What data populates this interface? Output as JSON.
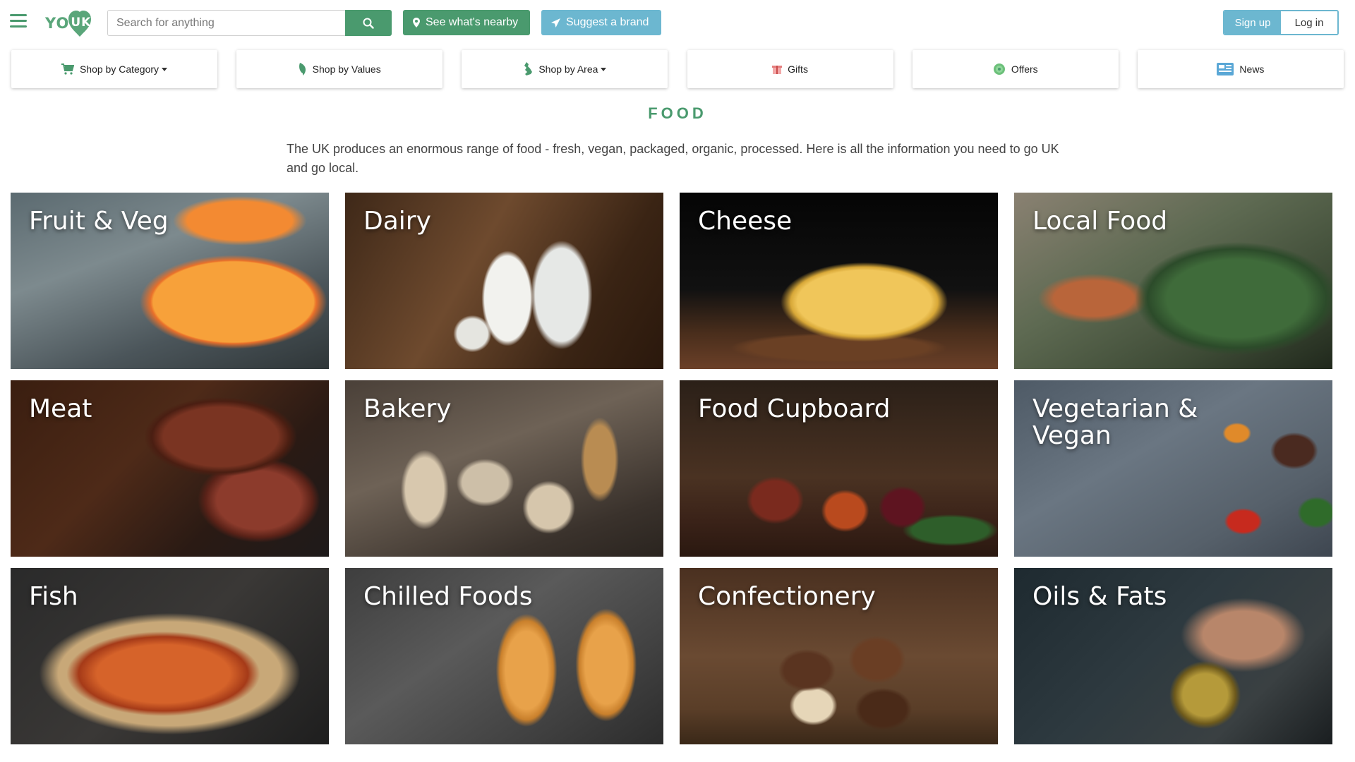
{
  "header": {
    "logo_text": "YO",
    "logo_badge": "UK",
    "search_placeholder": "Search for anything",
    "nearby_label": "See what's nearby",
    "suggest_label": "Suggest a brand",
    "signup_label": "Sign up",
    "login_label": "Log in"
  },
  "nav": {
    "items": [
      {
        "label": "Shop by Category",
        "icon": "cart-icon"
      },
      {
        "label": "Shop by Values",
        "icon": "leaf-icon"
      },
      {
        "label": "Shop by Area",
        "icon": "uk-map-icon"
      },
      {
        "label": "Gifts",
        "icon": "gift-icon"
      },
      {
        "label": "Offers",
        "icon": "badge-icon"
      },
      {
        "label": "News",
        "icon": "newspaper-icon"
      }
    ]
  },
  "page": {
    "title": "FOOD",
    "intro": "The UK produces an enormous range of food - fresh, vegan, packaged, organic, processed. Here is all the information you need to go UK and go local."
  },
  "categories": [
    {
      "label": "Fruit & Veg"
    },
    {
      "label": "Dairy"
    },
    {
      "label": "Cheese"
    },
    {
      "label": "Local Food"
    },
    {
      "label": "Meat"
    },
    {
      "label": "Bakery"
    },
    {
      "label": "Food Cupboard"
    },
    {
      "label": "Vegetarian & Vegan"
    },
    {
      "label": "Fish"
    },
    {
      "label": "Chilled Foods"
    },
    {
      "label": "Confectionery"
    },
    {
      "label": "Oils & Fats"
    }
  ],
  "colors": {
    "brand_green": "#4a9a6e",
    "accent_blue": "#6cb7d0"
  }
}
